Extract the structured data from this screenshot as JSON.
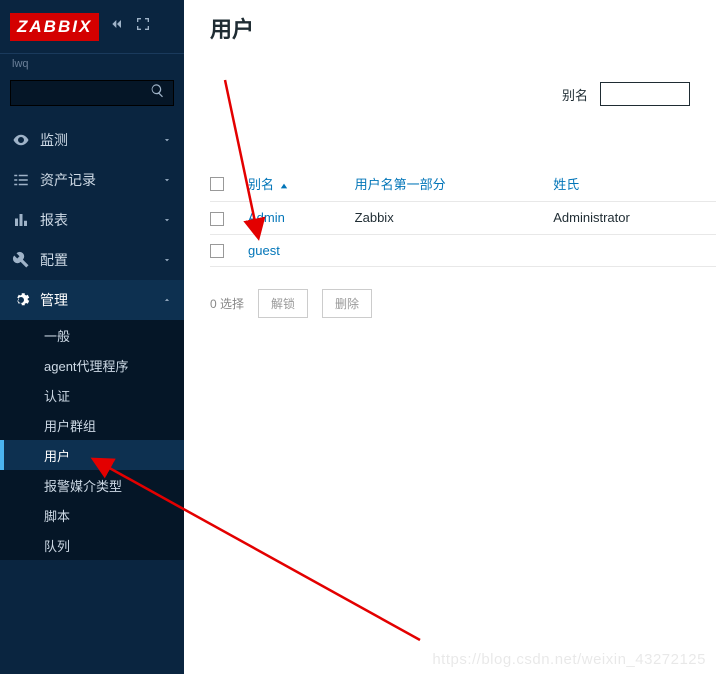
{
  "brand": "ZABBIX",
  "user_short": "lwq",
  "nav": {
    "items": [
      {
        "label": "监测"
      },
      {
        "label": "资产记录"
      },
      {
        "label": "报表"
      },
      {
        "label": "配置"
      },
      {
        "label": "管理"
      }
    ],
    "admin_sub": [
      {
        "label": "一般"
      },
      {
        "label": "agent代理程序"
      },
      {
        "label": "认证"
      },
      {
        "label": "用户群组"
      },
      {
        "label": "用户"
      },
      {
        "label": "报警媒介类型"
      },
      {
        "label": "脚本"
      },
      {
        "label": "队列"
      }
    ]
  },
  "page": {
    "title": "用户",
    "filter_label": "别名",
    "filter_value": ""
  },
  "table": {
    "cols": {
      "alias": "别名",
      "first": "用户名第一部分",
      "last": "姓氏"
    },
    "rows": [
      {
        "alias": "Admin",
        "first": "Zabbix",
        "last": "Administrator"
      },
      {
        "alias": "guest",
        "first": "",
        "last": ""
      }
    ]
  },
  "bulk": {
    "count_label": "0 选择",
    "unlock": "解锁",
    "delete": "删除"
  },
  "watermark": "https://blog.csdn.net/weixin_43272125"
}
